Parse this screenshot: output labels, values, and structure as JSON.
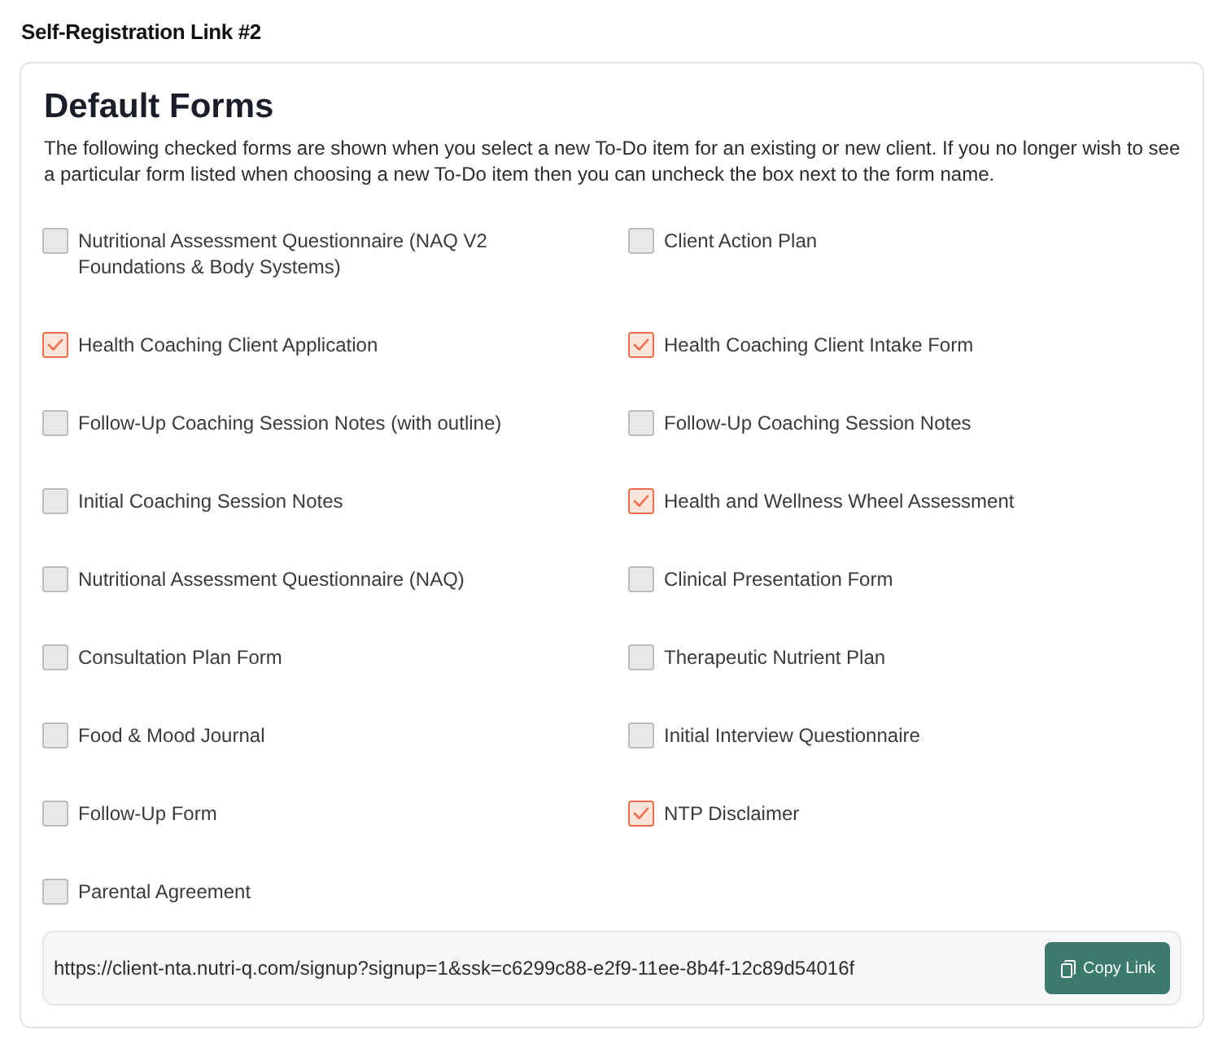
{
  "section_title": "Self-Registration Link #2",
  "card": {
    "title": "Default Forms",
    "description": "The following checked forms are shown when you select a new To-Do item for an existing or new client. If you no longer wish to see a particular form listed when choosing a new To-Do item then you can uncheck the box next to the form name.",
    "forms": [
      {
        "label": "Nutritional Assessment Questionnaire (NAQ V2 Foundations & Body Systems)",
        "checked": false
      },
      {
        "label": "Client Action Plan",
        "checked": false
      },
      {
        "label": "Health Coaching Client Application",
        "checked": true
      },
      {
        "label": "Health Coaching Client Intake Form",
        "checked": true
      },
      {
        "label": "Follow-Up Coaching Session Notes (with outline)",
        "checked": false
      },
      {
        "label": "Follow-Up Coaching Session Notes",
        "checked": false
      },
      {
        "label": "Initial Coaching Session Notes",
        "checked": false
      },
      {
        "label": "Health and Wellness Wheel Assessment",
        "checked": true
      },
      {
        "label": "Nutritional Assessment Questionnaire (NAQ)",
        "checked": false
      },
      {
        "label": "Clinical Presentation Form",
        "checked": false
      },
      {
        "label": "Consultation Plan Form",
        "checked": false
      },
      {
        "label": "Therapeutic Nutrient Plan",
        "checked": false
      },
      {
        "label": "Food & Mood Journal",
        "checked": false
      },
      {
        "label": "Initial Interview Questionnaire",
        "checked": false
      },
      {
        "label": "Follow-Up Form",
        "checked": false
      },
      {
        "label": "NTP Disclaimer",
        "checked": true
      },
      {
        "label": "Parental Agreement",
        "checked": false
      }
    ],
    "link": {
      "url": "https://client-nta.nutri-q.com/signup?signup=1&ssk=c6299c88-e2f9-11ee-8b4f-12c89d54016f",
      "button": "Copy Link"
    }
  }
}
